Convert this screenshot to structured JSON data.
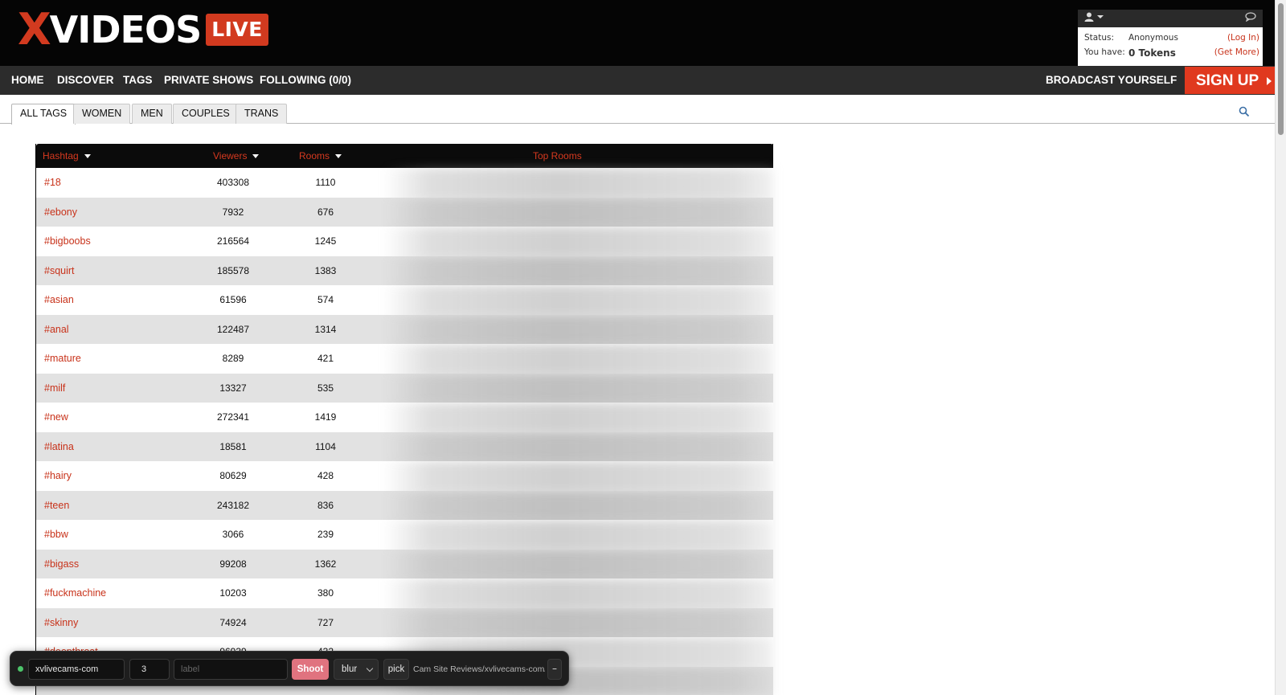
{
  "brand": {
    "logo_x": "X",
    "logo_main": "VIDEOS",
    "logo_badge": "LIVE"
  },
  "account": {
    "status_label": "Status:",
    "status_value": "Anonymous",
    "login_link": "(Log In)",
    "tokens_label": "You have:",
    "tokens_value": "0 Tokens",
    "get_more_link": "(Get More)"
  },
  "nav": {
    "items": [
      "HOME",
      "DISCOVER",
      "TAGS",
      "PRIVATE SHOWS",
      "FOLLOWING (0/0)"
    ],
    "broadcast": "BROADCAST YOURSELF",
    "signup": "SIGN UP"
  },
  "tabs": [
    "ALL TAGS",
    "WOMEN",
    "MEN",
    "COUPLES",
    "TRANS"
  ],
  "table": {
    "headers": {
      "hashtag": "Hashtag",
      "viewers": "Viewers",
      "rooms": "Rooms",
      "top_rooms": "Top Rooms"
    },
    "rows": [
      {
        "tag": "#18",
        "viewers": "403308",
        "rooms": "1110"
      },
      {
        "tag": "#ebony",
        "viewers": "7932",
        "rooms": "676"
      },
      {
        "tag": "#bigboobs",
        "viewers": "216564",
        "rooms": "1245"
      },
      {
        "tag": "#squirt",
        "viewers": "185578",
        "rooms": "1383"
      },
      {
        "tag": "#asian",
        "viewers": "61596",
        "rooms": "574"
      },
      {
        "tag": "#anal",
        "viewers": "122487",
        "rooms": "1314"
      },
      {
        "tag": "#mature",
        "viewers": "8289",
        "rooms": "421"
      },
      {
        "tag": "#milf",
        "viewers": "13327",
        "rooms": "535"
      },
      {
        "tag": "#new",
        "viewers": "272341",
        "rooms": "1419"
      },
      {
        "tag": "#latina",
        "viewers": "18581",
        "rooms": "1104"
      },
      {
        "tag": "#hairy",
        "viewers": "80629",
        "rooms": "428"
      },
      {
        "tag": "#teen",
        "viewers": "243182",
        "rooms": "836"
      },
      {
        "tag": "#bbw",
        "viewers": "3066",
        "rooms": "239"
      },
      {
        "tag": "#bigass",
        "viewers": "99208",
        "rooms": "1362"
      },
      {
        "tag": "#fuckmachine",
        "viewers": "10203",
        "rooms": "380"
      },
      {
        "tag": "#skinny",
        "viewers": "74924",
        "rooms": "727"
      },
      {
        "tag": "#deepthroat",
        "viewers": "96939",
        "rooms": "432"
      },
      {
        "tag": "",
        "viewers": "",
        "rooms": ""
      }
    ]
  },
  "toolbar": {
    "site_value": "xvlivecams-com",
    "count_value": "3",
    "label_placeholder": "label",
    "shoot_label": "Shoot",
    "mode_value": "blur",
    "pick_label": "pick",
    "path_text": "Cam Site Reviews/xvlivecams-com/",
    "minimize_label": "–"
  }
}
